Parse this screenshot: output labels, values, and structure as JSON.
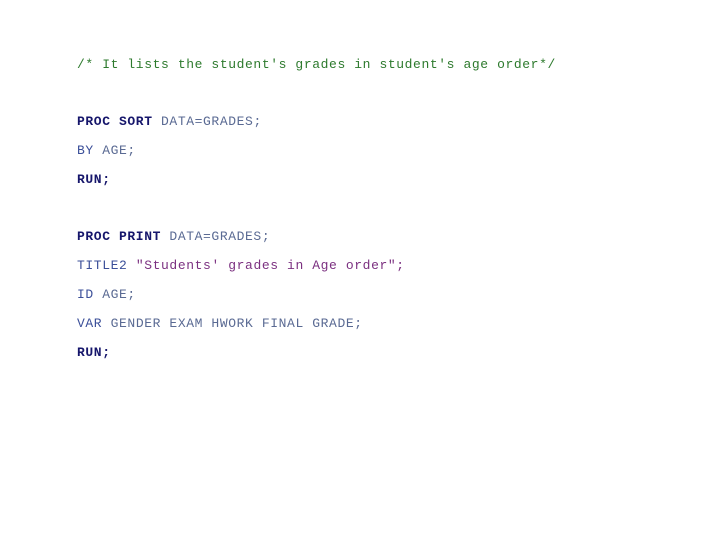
{
  "slide": {
    "background_color": "#ffffff",
    "language": "SAS",
    "comment_color": "#2d7a2d",
    "keyword_color": "#16166b",
    "statement_color": "#3b4f99",
    "plain_color": "#5a6a93",
    "string_color": "#7b3080"
  },
  "comment": {
    "text": "/* It lists the student's grades in student's age order*/"
  },
  "proc_sort_block": {
    "line1": {
      "keyword": "PROC SORT",
      "rest": " DATA=GRADES;"
    },
    "line2": {
      "statement": "BY",
      "rest": " AGE;"
    },
    "line3": {
      "keyword": "RUN;"
    }
  },
  "proc_print_block": {
    "line1": {
      "keyword": "PROC PRINT",
      "rest": " DATA=GRADES;"
    },
    "line2": {
      "statement": "TITLE2",
      "space": " ",
      "string": "\"Students' grades in Age order\";"
    },
    "line3": {
      "statement": "ID",
      "rest": " AGE;"
    },
    "line4": {
      "statement": "VAR",
      "rest": " GENDER EXAM HWORK FINAL GRADE;"
    },
    "line5": {
      "keyword": "RUN;"
    }
  }
}
